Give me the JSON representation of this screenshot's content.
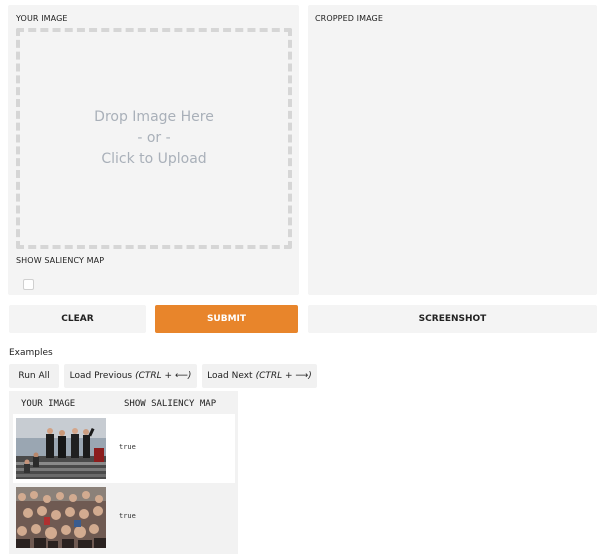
{
  "input_panel": {
    "label": "YOUR IMAGE",
    "dropzone": {
      "line1": "Drop Image Here",
      "line2": "- or -",
      "line3": "Click to Upload"
    },
    "checkbox_label": "SHOW SALIENCY MAP",
    "checkbox_checked": false
  },
  "output_panel": {
    "label": "CROPPED IMAGE"
  },
  "actions": {
    "clear": "CLEAR",
    "submit": "SUBMIT",
    "screenshot": "SCREENSHOT",
    "submit_color": "#e8852b"
  },
  "examples": {
    "title": "Examples",
    "run_all": "Run All",
    "load_previous": "Load Previous",
    "load_previous_hint": "(CTRL + ⟵)",
    "load_next": "Load Next",
    "load_next_hint": "(CTRL + ⟶)",
    "columns": [
      "YOUR IMAGE",
      "SHOW SALIENCY MAP"
    ],
    "rows": [
      {
        "image": "photo of group of people on stairs",
        "saliency": "true"
      },
      {
        "image": "photo of large crowd",
        "saliency": "true"
      }
    ]
  }
}
